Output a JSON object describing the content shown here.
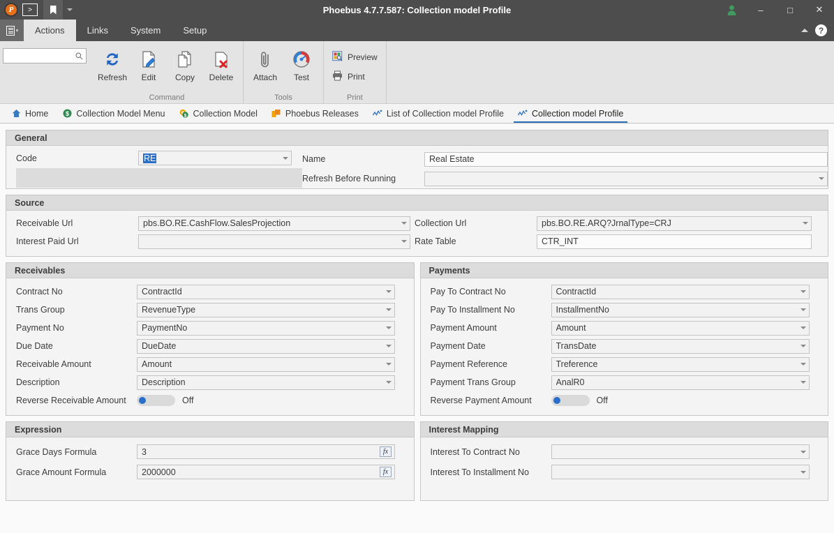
{
  "titlebar": {
    "app_title": "Phoebus 4.7.7.587: Collection model Profile",
    "quick_access": [
      {
        "name": "app-logo",
        "label": "P"
      },
      {
        "name": "console-button",
        "label": ">"
      },
      {
        "name": "bookmark-button",
        "label": ""
      },
      {
        "name": "customize-qat-caret",
        "label": ""
      }
    ],
    "user_icon": "user-icon",
    "minimize": "–",
    "maximize": "□",
    "close": "✕"
  },
  "menubar": {
    "app_button": "menu-app-button",
    "items": [
      {
        "label": "Actions",
        "active": true
      },
      {
        "label": "Links",
        "active": false
      },
      {
        "label": "System",
        "active": false
      },
      {
        "label": "Setup",
        "active": false
      }
    ],
    "collapse_ribbon": "chevron-up-icon",
    "help": "?"
  },
  "ribbon": {
    "search_placeholder": "",
    "search_value": "",
    "groups": [
      {
        "title": "Command",
        "buttons": [
          {
            "label": "Refresh",
            "icon": "refresh-icon"
          },
          {
            "label": "Edit",
            "icon": "edit-icon"
          },
          {
            "label": "Copy",
            "icon": "copy-icon"
          },
          {
            "label": "Delete",
            "icon": "delete-icon"
          }
        ]
      },
      {
        "title": "Tools",
        "buttons": [
          {
            "label": "Attach",
            "icon": "attach-icon"
          },
          {
            "label": "Test",
            "icon": "test-icon"
          }
        ]
      },
      {
        "title": "Print",
        "buttons": [
          {
            "label": "Preview",
            "icon": "preview-icon"
          },
          {
            "label": "Print",
            "icon": "print-icon"
          }
        ]
      }
    ]
  },
  "doctabs": [
    {
      "label": "Home",
      "icon": "home-icon",
      "active": false
    },
    {
      "label": "Collection Model Menu",
      "icon": "dollar-coin-icon",
      "active": false
    },
    {
      "label": "Collection Model",
      "icon": "euro-coin-icon",
      "active": false
    },
    {
      "label": "Phoebus Releases",
      "icon": "boxes-icon",
      "active": false
    },
    {
      "label": "List of Collection model Profile",
      "icon": "chart-line-icon",
      "active": false
    },
    {
      "label": "Collection model Profile",
      "icon": "chart-line-icon",
      "active": true
    }
  ],
  "general": {
    "title": "General",
    "code_label": "Code",
    "code_value": "RE",
    "name_label": "Name",
    "name_value": "Real Estate",
    "refresh_before_running_label": "Refresh Before Running",
    "refresh_before_running_value": ""
  },
  "source": {
    "title": "Source",
    "receivable_url_label": "Receivable Url",
    "receivable_url_value": "pbs.BO.RE.CashFlow.SalesProjection",
    "interest_paid_url_label": "Interest Paid Url",
    "interest_paid_url_value": "",
    "collection_url_label": "Collection Url",
    "collection_url_value": "pbs.BO.RE.ARQ?JrnalType=CRJ",
    "rate_table_label": "Rate Table",
    "rate_table_value": "CTR_INT"
  },
  "receivables": {
    "title": "Receivables",
    "fields": [
      {
        "label": "Contract No",
        "value": "ContractId"
      },
      {
        "label": "Trans Group",
        "value": "RevenueType"
      },
      {
        "label": "Payment No",
        "value": "PaymentNo"
      },
      {
        "label": "Due Date",
        "value": "DueDate"
      },
      {
        "label": "Receivable Amount",
        "value": "Amount"
      },
      {
        "label": "Description",
        "value": "Description"
      }
    ],
    "toggle_label": "Reverse Receivable Amount",
    "toggle_state": "Off"
  },
  "payments": {
    "title": "Payments",
    "fields": [
      {
        "label": "Pay To Contract No",
        "value": "ContractId"
      },
      {
        "label": "Pay To Installment No",
        "value": "InstallmentNo"
      },
      {
        "label": "Payment Amount",
        "value": "Amount"
      },
      {
        "label": "Payment Date",
        "value": "TransDate"
      },
      {
        "label": "Payment Reference",
        "value": "Treference"
      },
      {
        "label": "Payment Trans Group",
        "value": "AnalR0"
      }
    ],
    "toggle_label": "Reverse Payment Amount",
    "toggle_state": "Off"
  },
  "expression": {
    "title": "Expression",
    "fields": [
      {
        "label": "Grace Days Formula",
        "value": "3",
        "button": "fx"
      },
      {
        "label": "Grace Amount Formula",
        "value": "2000000",
        "button": "fx"
      }
    ]
  },
  "interest_mapping": {
    "title": "Interest Mapping",
    "fields": [
      {
        "label": "Interest To Contract No",
        "value": ""
      },
      {
        "label": "Interest To Installment No",
        "value": ""
      }
    ]
  },
  "colors": {
    "titlebar_bg": "#4d4d4d",
    "accent_blue": "#2a6db5",
    "selection_blue": "#2a6ecb",
    "ribbon_bg": "#e4e4e4",
    "panel_header_bg": "#dcdcdc",
    "logo_orange": "#e8701a",
    "user_green": "#3f9c5e"
  }
}
